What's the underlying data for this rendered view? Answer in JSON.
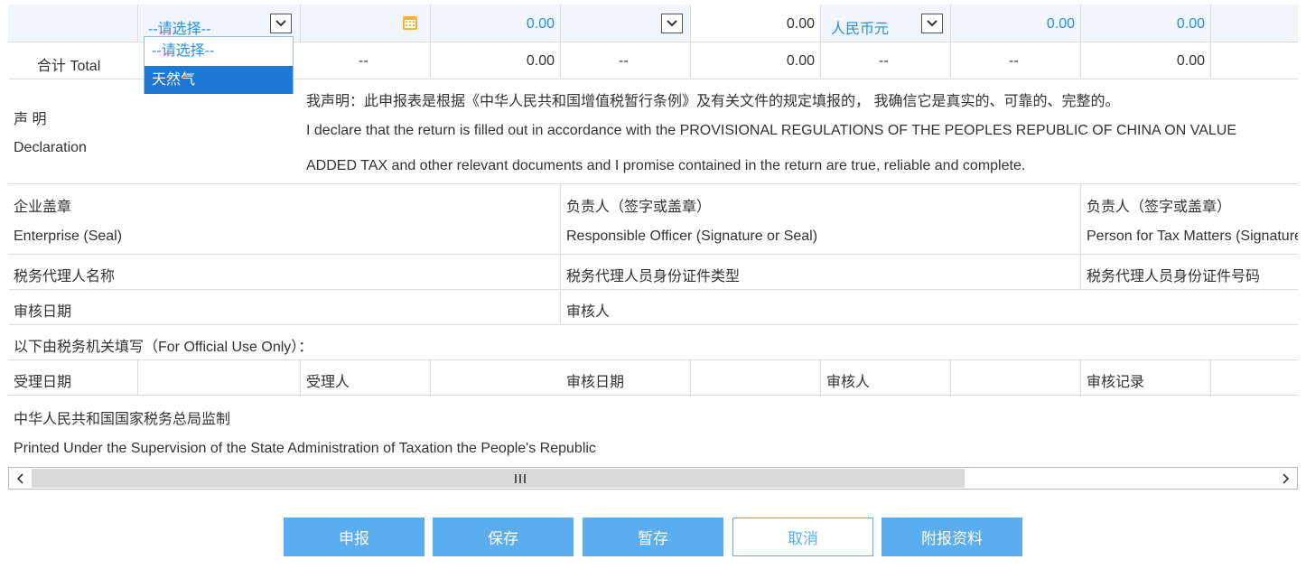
{
  "top_row": {
    "category_select": "--请选择--",
    "calendar_icon": "calendar-icon",
    "amount1": "0.00",
    "amount2": "0.00",
    "currency_select": "人民币元",
    "amount3": "0.00",
    "amount4": "0.00"
  },
  "dropdown": {
    "options": [
      "--请选择--",
      "天然气"
    ],
    "highlighted": "天然气"
  },
  "total_row": {
    "label": "合计 Total",
    "dash": "--",
    "amount1": "0.00",
    "amount2": "0.00",
    "amount3": "0.00"
  },
  "declaration": {
    "label_cn": "声 明",
    "label_en": "Declaration",
    "text_cn": "我声明：此申报表是根据《中华人民共和国增值税暂行条例》及有关文件的规定填报的， 我确信它是真实的、可靠的、完整的。",
    "text_en_1": "I declare that the return is filled out in accordance with the PROVISIONAL REGULATIONS OF THE PEOPLES REPUBLIC OF CHINA ON VALUE",
    "text_en_2": "ADDED TAX and other relevant documents and I promise contained in the return are true, reliable and complete."
  },
  "signatures": {
    "enterprise_cn": "企业盖章",
    "enterprise_en": "Enterprise (Seal)",
    "officer_cn": "负责人（签字或盖章）",
    "officer_en": "Responsible Officer (Signature or Seal)",
    "tax_person_cn": "负责人（签字或盖章）",
    "tax_person_en": "Person for Tax Matters (Signature or Seal)"
  },
  "agent": {
    "name": "税务代理人名称",
    "id_type": "税务代理人员身份证件类型",
    "id_number": "税务代理人员身份证件号码"
  },
  "review": {
    "date": "审核日期",
    "reviewer": "审核人"
  },
  "official": {
    "heading": "以下由税务机关填写（For Official Use Only）：",
    "accept_date": "受理日期",
    "acceptor": "受理人",
    "review_date": "审核日期",
    "reviewer": "审核人",
    "review_record": "审核记录"
  },
  "footer": {
    "supervision_cn": "中华人民共和国国家税务总局监制",
    "supervision_en": "Printed Under the Supervision of the State Administration of Taxation the People's Republic"
  },
  "buttons": {
    "submit": "申报",
    "save": "保存",
    "temp_save": "暂存",
    "cancel": "取消",
    "attach": "附报资料"
  },
  "colors": {
    "accent": "#5aaef0",
    "highlight": "#1e78d6",
    "link_blue": "#2a8fd3"
  }
}
